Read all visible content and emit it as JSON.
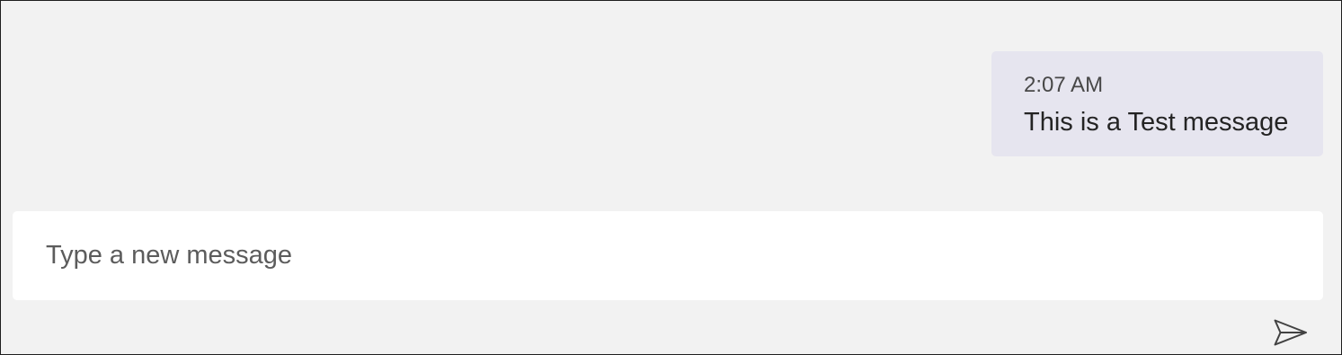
{
  "message": {
    "timestamp": "2:07 AM",
    "text": "This is a Test message"
  },
  "composer": {
    "placeholder": "Type a new message",
    "value": "",
    "send_icon": "send-icon"
  },
  "colors": {
    "window_background": "#f2f2f2",
    "bubble_background": "#e6e5ef",
    "composer_background": "#ffffff",
    "text_primary": "#242424",
    "text_secondary": "#484848",
    "icon": "#424242"
  }
}
